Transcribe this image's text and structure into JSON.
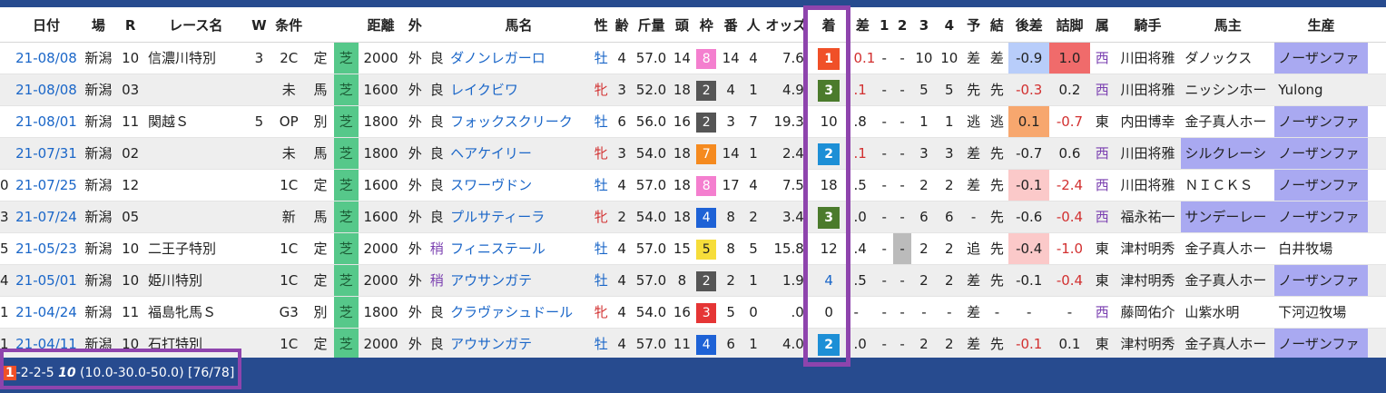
{
  "header": [
    "日付",
    "場",
    "R",
    "レース名",
    "W",
    "条件",
    "",
    "距離",
    "外",
    "",
    "馬名",
    "性",
    "齢",
    "斤量",
    "頭",
    "枠",
    "番",
    "人",
    "オッズ",
    "着",
    "差",
    "1",
    "2",
    "3",
    "4",
    "予",
    "結",
    "後差",
    "詰脚",
    "属",
    "騎手",
    "馬主",
    "生産",
    ""
  ],
  "rows": [
    {
      "no": "",
      "date": "21-08/08",
      "place": "新潟",
      "r": "10",
      "race": "信濃川特別",
      "w": "3",
      "cls": "2C",
      "cond": "定",
      "surf": "芝",
      "dist": "2000",
      "out": "外",
      "going": "良",
      "horse": "ダノンレガーロ",
      "sex": "牡",
      "age": "4",
      "weight": "57.0",
      "runners": "14",
      "waku": "8",
      "num": "14",
      "pop": "4",
      "odds": "7.6",
      "pos": "1",
      "diff": "0.1",
      "c1": "-",
      "c2": "-",
      "c3": "10",
      "c4": "10",
      "yo": "差",
      "ke": "差",
      "atosa": "-0.9",
      "tsume": "1.0",
      "zoku": "西",
      "jockey": "川田将雅",
      "owner": "ダノックス",
      "breeder": "ノーザンファ",
      "extra": "",
      "atosaC": "c-blue",
      "tsumeC": "c-red",
      "ownerC": "",
      "breederC": "lav",
      "posC": "p-red",
      "popC": "",
      "goingC": ""
    },
    {
      "no": "",
      "date": "21-08/08",
      "place": "新潟",
      "r": "03",
      "race": "",
      "w": "",
      "cls": "未",
      "cond": "馬",
      "surf": "芝",
      "dist": "1600",
      "out": "外",
      "going": "良",
      "horse": "レイクビワ",
      "sex": "牝",
      "age": "3",
      "weight": "52.0",
      "runners": "18",
      "waku": "2",
      "num": "4",
      "pop": "1",
      "odds": "4.9",
      "pos": "3",
      "diff": ".1",
      "c1": "-",
      "c2": "-",
      "c3": "5",
      "c4": "5",
      "yo": "先",
      "ke": "先",
      "atosa": "-0.3",
      "tsume": "0.2",
      "zoku": "西",
      "jockey": "川田将雅",
      "owner": "ニッシンホー",
      "breeder": "Yulong",
      "extra": "",
      "atosaC": "",
      "tsumeC": "c-green",
      "ownerC": "",
      "breederC": "",
      "posC": "p-green",
      "popC": "pop1",
      "goingC": ""
    },
    {
      "no": "",
      "date": "21-08/01",
      "place": "新潟",
      "r": "11",
      "race": "関越Ｓ",
      "w": "5",
      "cls": "OP",
      "cond": "別",
      "surf": "芝",
      "dist": "1800",
      "out": "外",
      "going": "良",
      "horse": "フォックスクリーク",
      "sex": "牡",
      "age": "6",
      "weight": "56.0",
      "runners": "16",
      "waku": "2",
      "num": "3",
      "pop": "7",
      "odds": "19.3",
      "pos": "10",
      "diff": ".8",
      "c1": "-",
      "c2": "-",
      "c3": "1",
      "c4": "1",
      "yo": "逃",
      "ke": "逃",
      "atosa": "0.1",
      "tsume": "-0.7",
      "zoku": "東",
      "jockey": "内田博幸",
      "owner": "金子真人ホー",
      "breeder": "ノーザンファ",
      "extra": "",
      "atosaC": "c-orange",
      "tsumeC": "",
      "ownerC": "",
      "breederC": "lav",
      "posC": "",
      "popC": "",
      "goingC": ""
    },
    {
      "no": "",
      "date": "21-07/31",
      "place": "新潟",
      "r": "02",
      "race": "",
      "w": "",
      "cls": "未",
      "cond": "馬",
      "surf": "芝",
      "dist": "1800",
      "out": "外",
      "going": "良",
      "horse": "ヘアケイリー",
      "sex": "牝",
      "age": "3",
      "weight": "54.0",
      "runners": "18",
      "waku": "7",
      "num": "14",
      "pop": "1",
      "odds": "2.4",
      "pos": "2",
      "diff": ".1",
      "c1": "-",
      "c2": "-",
      "c3": "3",
      "c4": "3",
      "yo": "差",
      "ke": "先",
      "atosa": "-0.7",
      "tsume": "0.6",
      "zoku": "西",
      "jockey": "川田将雅",
      "owner": "シルクレーシ",
      "breeder": "ノーザンファ",
      "extra": "",
      "atosaC": "c-blue",
      "tsumeC": "c-red",
      "ownerC": "lav",
      "breederC": "lav",
      "posC": "p-blue",
      "popC": "pop1",
      "goingC": ""
    },
    {
      "no": "0",
      "date": "21-07/25",
      "place": "新潟",
      "r": "12",
      "race": "",
      "w": "",
      "cls": "1C",
      "cond": "定",
      "surf": "芝",
      "dist": "1600",
      "out": "外",
      "going": "良",
      "horse": "スワーヴドン",
      "sex": "牡",
      "age": "4",
      "weight": "57.0",
      "runners": "18",
      "waku": "8",
      "num": "17",
      "pop": "4",
      "odds": "7.5",
      "pos": "18",
      "diff": ".5",
      "c1": "-",
      "c2": "-",
      "c3": "2",
      "c4": "2",
      "yo": "差",
      "ke": "先",
      "atosa": "-0.1",
      "tsume": "-2.4",
      "zoku": "西",
      "jockey": "川田将雅",
      "owner": "ＮＩＣＫＳ",
      "breeder": "ノーザンファ",
      "extra": "",
      "atosaC": "c-pink",
      "tsumeC": "",
      "ownerC": "",
      "breederC": "lav",
      "posC": "",
      "popC": "",
      "goingC": ""
    },
    {
      "no": "3",
      "date": "21-07/24",
      "place": "新潟",
      "r": "05",
      "race": "",
      "w": "",
      "cls": "新",
      "cond": "馬",
      "surf": "芝",
      "dist": "1600",
      "out": "外",
      "going": "良",
      "horse": "プルサティーラ",
      "sex": "牝",
      "age": "2",
      "weight": "54.0",
      "runners": "18",
      "waku": "4",
      "num": "8",
      "pop": "2",
      "odds": "3.4",
      "pos": "3",
      "diff": ".0",
      "c1": "-",
      "c2": "-",
      "c3": "6",
      "c4": "6",
      "yo": "-",
      "ke": "先",
      "atosa": "-0.6",
      "tsume": "-0.4",
      "zoku": "西",
      "jockey": "福永祐一",
      "owner": "サンデーレー",
      "breeder": "ノーザンファ",
      "extra": "",
      "atosaC": "c-blue",
      "tsumeC": "",
      "ownerC": "lav",
      "breederC": "lav",
      "posC": "p-green",
      "popC": "pop2",
      "goingC": ""
    },
    {
      "no": "5",
      "date": "21-05/23",
      "place": "新潟",
      "r": "10",
      "race": "二王子特別",
      "w": "",
      "cls": "1C",
      "cond": "定",
      "surf": "芝",
      "dist": "2000",
      "out": "外",
      "going": "稍",
      "horse": "フィニステール",
      "sex": "牡",
      "age": "4",
      "weight": "57.0",
      "runners": "15",
      "waku": "5",
      "num": "8",
      "pop": "5",
      "odds": "15.8",
      "pos": "12",
      "diff": ".4",
      "c1": "-",
      "c2": "-",
      "c3": "2",
      "c4": "2",
      "yo": "追",
      "ke": "先",
      "atosa": "-0.4",
      "tsume": "-1.0",
      "zoku": "東",
      "jockey": "津村明秀",
      "owner": "金子真人ホー",
      "breeder": "白井牧場",
      "extra": "",
      "atosaC": "c-pink",
      "tsumeC": "",
      "ownerC": "",
      "breederC": "",
      "posC": "",
      "popC": "",
      "goingC": "purple"
    },
    {
      "no": "4",
      "date": "21-05/01",
      "place": "新潟",
      "r": "10",
      "race": "姫川特別",
      "w": "",
      "cls": "1C",
      "cond": "定",
      "surf": "芝",
      "dist": "2000",
      "out": "外",
      "going": "稍",
      "horse": "アウサンガテ",
      "sex": "牡",
      "age": "4",
      "weight": "57.0",
      "runners": "8",
      "waku": "2",
      "num": "2",
      "pop": "1",
      "odds": "1.9",
      "pos": "4",
      "diff": ".5",
      "c1": "-",
      "c2": "-",
      "c3": "2",
      "c4": "2",
      "yo": "差",
      "ke": "先",
      "atosa": "-0.1",
      "tsume": "-0.4",
      "zoku": "東",
      "jockey": "津村明秀",
      "owner": "金子真人ホー",
      "breeder": "ノーザンファ",
      "extra": "",
      "atosaC": "c-pink",
      "tsumeC": "",
      "ownerC": "",
      "breederC": "lav",
      "posC": "",
      "popC": "pop1",
      "goingC": "purple"
    },
    {
      "no": "1",
      "date": "21-04/24",
      "place": "新潟",
      "r": "11",
      "race": "福島牝馬Ｓ",
      "w": "",
      "cls": "G3",
      "cond": "別",
      "surf": "芝",
      "dist": "1800",
      "out": "外",
      "going": "良",
      "horse": "クラヴァシュドール",
      "sex": "牝",
      "age": "4",
      "weight": "54.0",
      "runners": "16",
      "waku": "3",
      "num": "5",
      "pop": "0",
      "odds": ".0",
      "pos": "0",
      "diff": "-",
      "c1": "-",
      "c2": "-",
      "c3": "-",
      "c4": "-",
      "yo": "差",
      "ke": "-",
      "atosa": "-",
      "tsume": "-",
      "zoku": "西",
      "jockey": "藤岡佑介",
      "owner": "山紫水明",
      "breeder": "下河辺牧場",
      "extra": "",
      "atosaC": "",
      "tsumeC": "",
      "ownerC": "",
      "breederC": "",
      "posC": "",
      "popC": "",
      "goingC": ""
    },
    {
      "no": "1",
      "date": "21-04/11",
      "place": "新潟",
      "r": "10",
      "race": "石打特別",
      "w": "",
      "cls": "1C",
      "cond": "定",
      "surf": "芝",
      "dist": "2000",
      "out": "外",
      "going": "良",
      "horse": "アウサンガテ",
      "sex": "牡",
      "age": "4",
      "weight": "57.0",
      "runners": "11",
      "waku": "4",
      "num": "6",
      "pop": "1",
      "odds": "4.0",
      "pos": "2",
      "diff": ".0",
      "c1": "-",
      "c2": "-",
      "c3": "2",
      "c4": "2",
      "yo": "差",
      "ke": "先",
      "atosa": "-0.1",
      "tsume": "0.1",
      "zoku": "東",
      "jockey": "津村明秀",
      "owner": "金子真人ホー",
      "breeder": "ノーザンファ",
      "extra": "",
      "atosaC": "",
      "tsumeC": "c-green",
      "ownerC": "",
      "breederC": "lav",
      "posC": "p-blue",
      "popC": "pop1",
      "goingC": ""
    }
  ],
  "footer": {
    "first": "1",
    "rest": "-2-2-5 ",
    "bold": "10",
    "tail": " (10.0-30.0-50.0) [76/78]"
  }
}
